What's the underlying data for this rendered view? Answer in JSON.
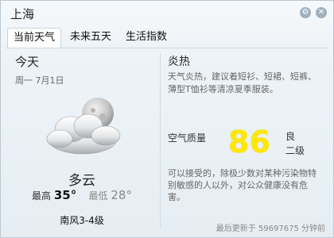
{
  "window": {
    "city": "上海",
    "controls": {
      "settings_glyph": "⚙",
      "close_glyph": "✕"
    }
  },
  "tabs": [
    {
      "label": "当前天气",
      "active": true
    },
    {
      "label": "未来五天",
      "active": false
    },
    {
      "label": "生活指数",
      "active": false
    }
  ],
  "today": {
    "label": "今天",
    "date": "周一 7月1日",
    "icon": "cloudy-moon-icon",
    "condition": "多云",
    "high_label": "最高",
    "high_value": "35°",
    "low_label": "最低",
    "low_value": "28°",
    "wind": "南风3-4级"
  },
  "comfort": {
    "title": "炎热",
    "text": "天气炎热，建议着短衫、短裙、短裤、薄型T恤衫等清凉夏季服装。"
  },
  "air_quality": {
    "label": "空气质量",
    "value": "86",
    "level_line1": "良",
    "level_line2": "二级",
    "description": "可以接受的，除极少数对某种污染物特别敏感的人以外，对公众健康没有危害。",
    "value_color": "#ffe800"
  },
  "footer": {
    "updated": "最后更新于 59697675 分钟前"
  }
}
